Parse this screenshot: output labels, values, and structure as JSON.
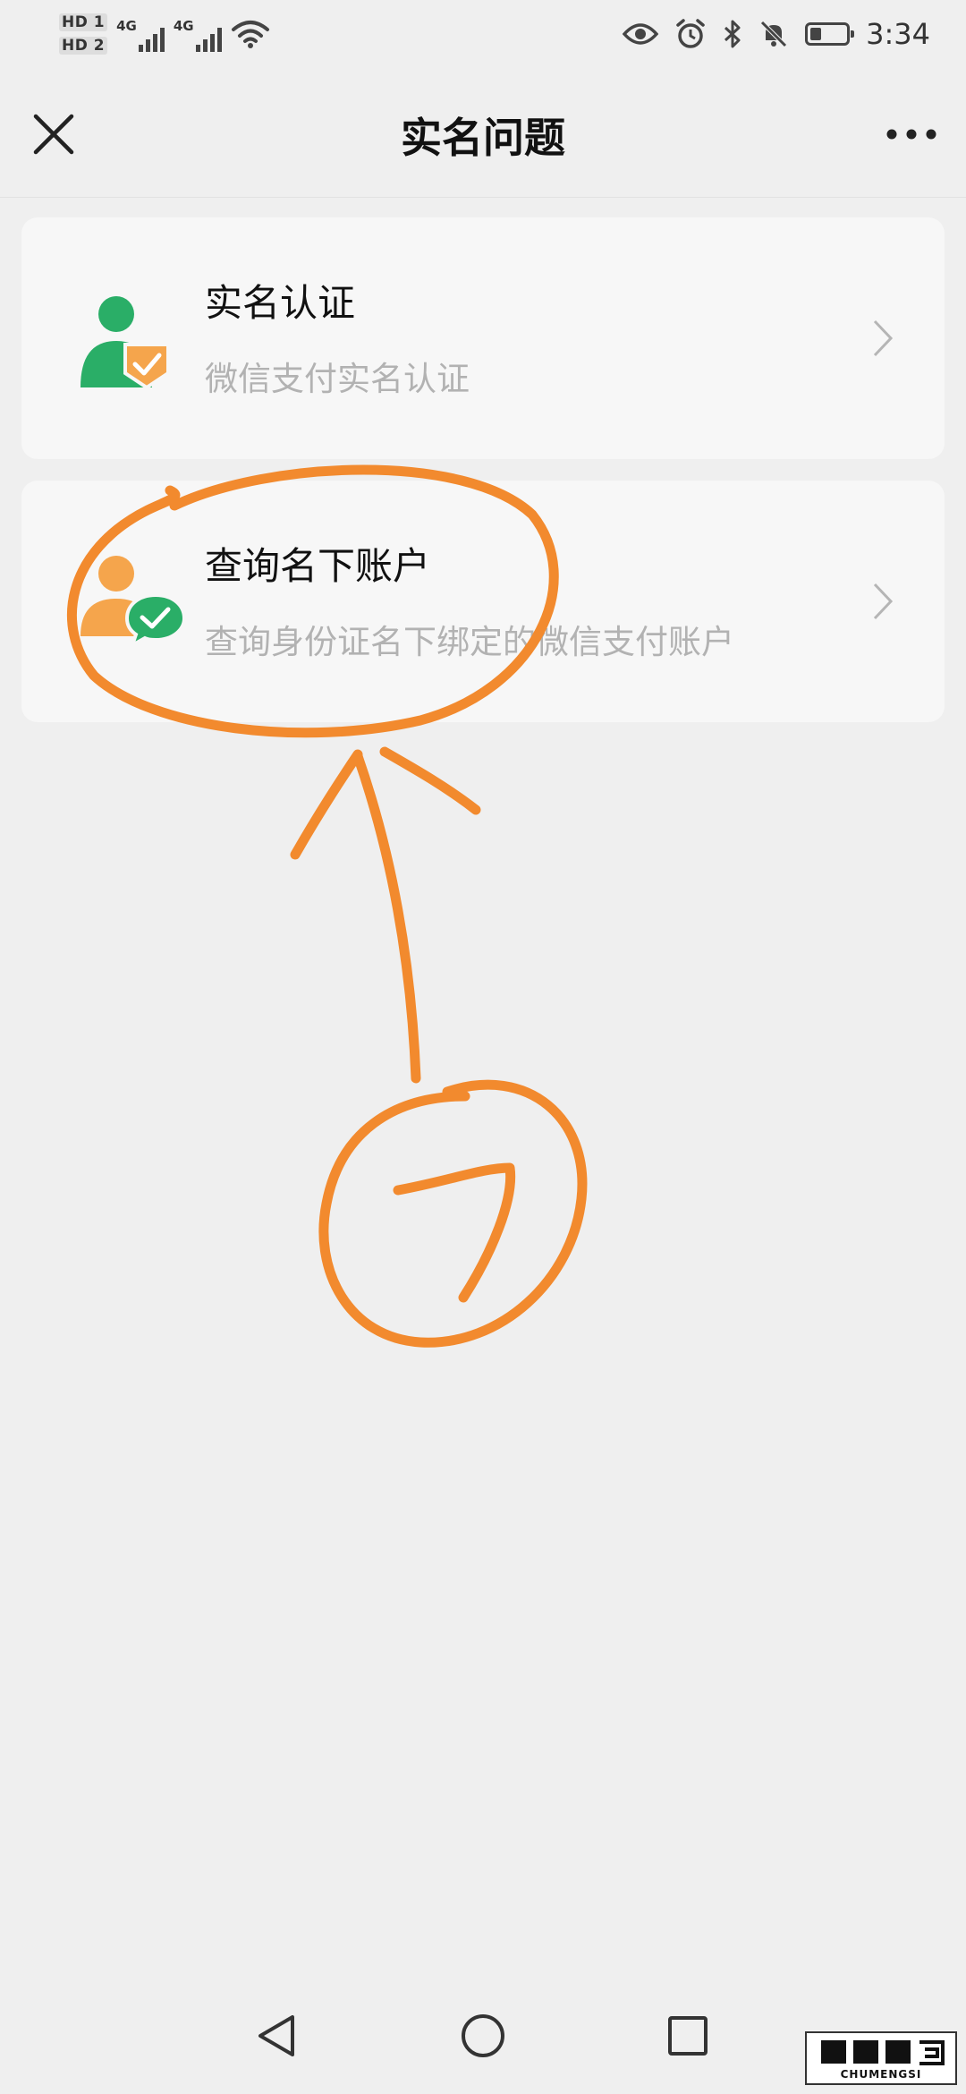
{
  "status_bar": {
    "sim1_label": "HD 1",
    "sim2_label": "HD 2",
    "network1_label": "4G",
    "network2_label": "4G",
    "time": "3:34",
    "icons": [
      "signal-icon",
      "wifi-icon",
      "eye-icon",
      "alarm-icon",
      "bluetooth-icon",
      "mute-icon",
      "battery-icon"
    ],
    "battery_level_percent": 30
  },
  "header": {
    "title": "实名问题",
    "close_icon": "close-icon",
    "more_icon": "more-icon"
  },
  "cards": [
    {
      "title": "实名认证",
      "subtitle": "微信支付实名认证",
      "icon": "verified-user-icon"
    },
    {
      "title": "查询名下账户",
      "subtitle": "查询身份证名下绑定的微信支付账户",
      "icon": "account-check-icon"
    }
  ],
  "annotation": {
    "step_number": "7",
    "color": "#f28a2e"
  },
  "colors": {
    "background": "#efefef",
    "card": "#f7f7f7",
    "green": "#2aae67",
    "orange": "#f5a54c",
    "subtitle": "#b2b2b2"
  },
  "nav_bar": {
    "icons": [
      "back-icon",
      "home-icon",
      "recent-apps-icon"
    ]
  },
  "watermark": {
    "text": "CHUMENGSI"
  }
}
